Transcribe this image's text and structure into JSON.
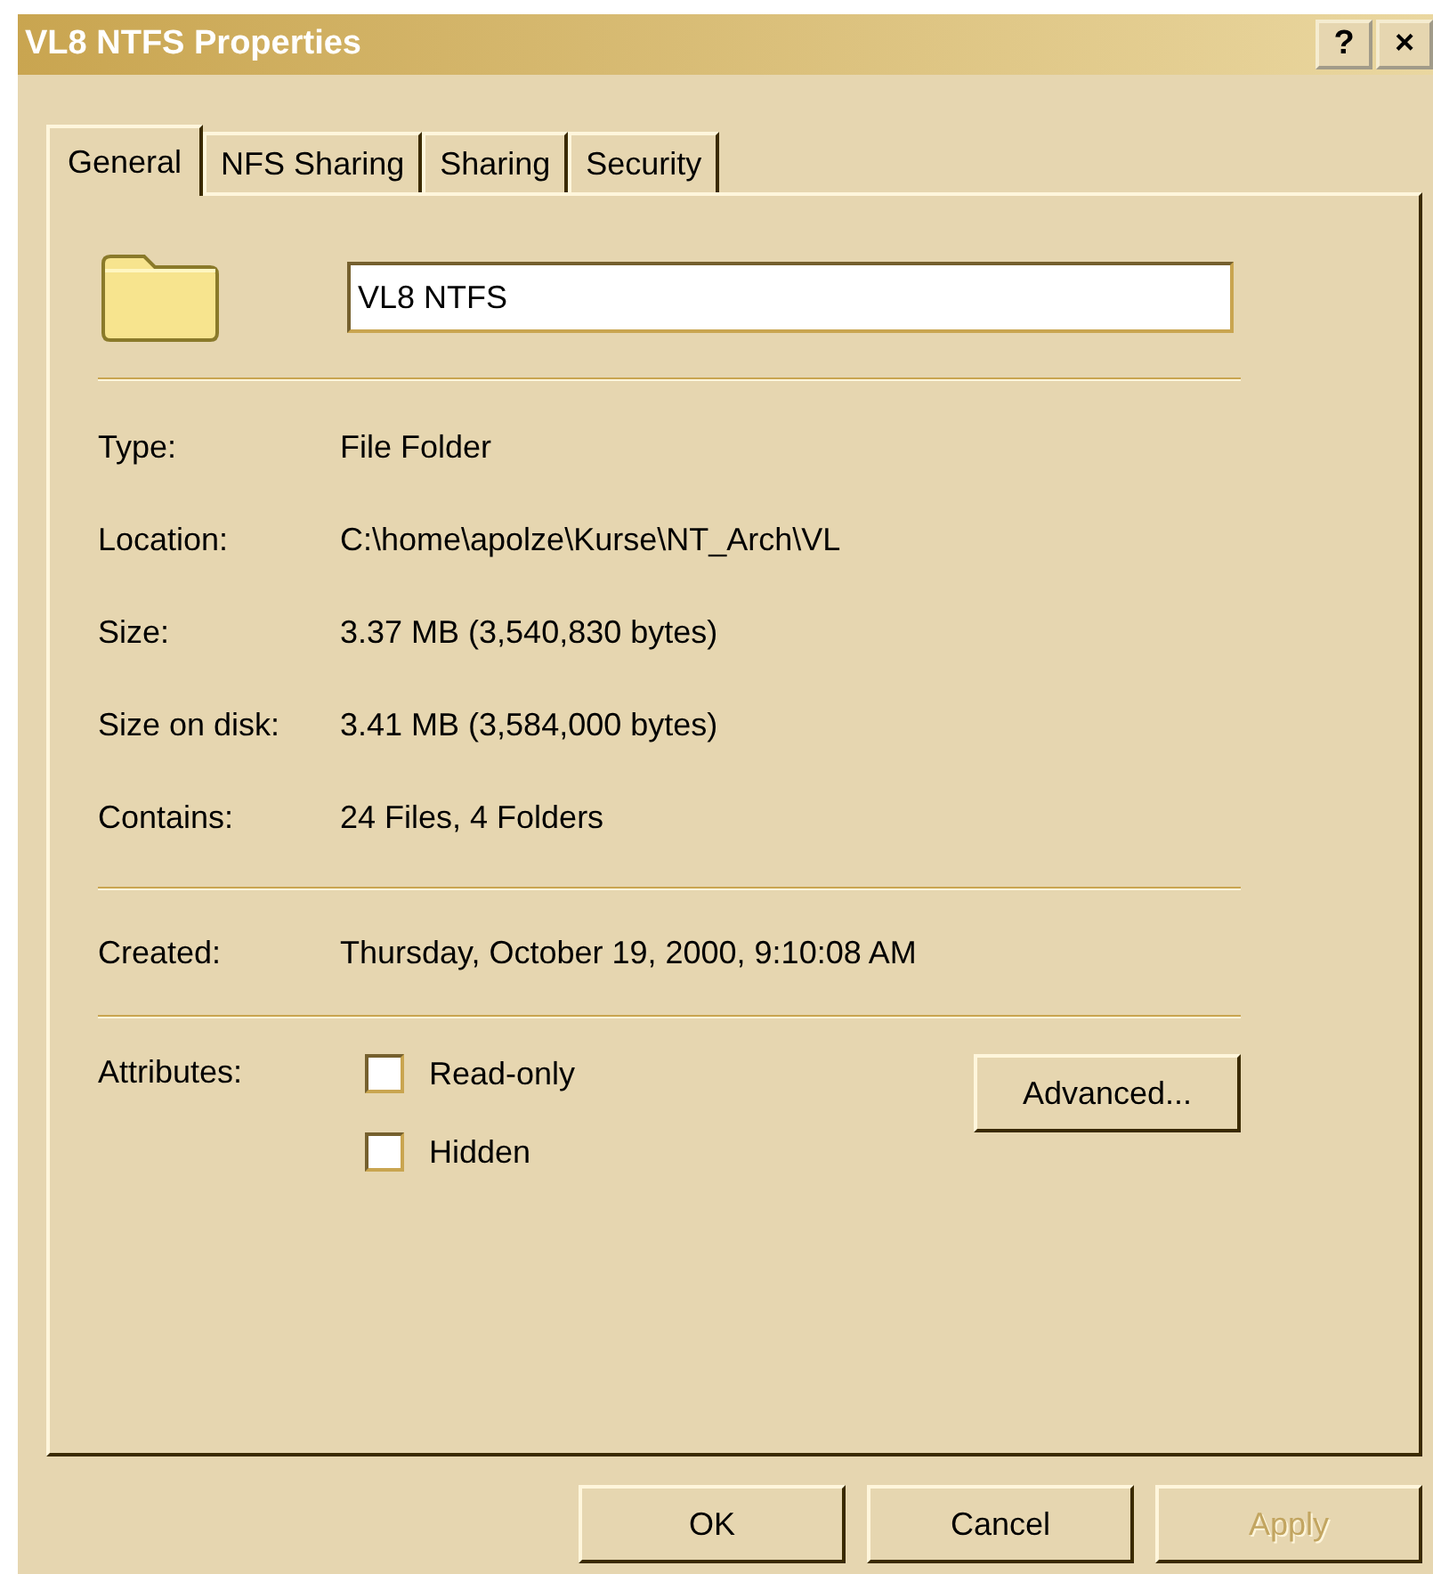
{
  "window": {
    "title": "VL8 NTFS Properties",
    "controls": [
      "?",
      "×"
    ]
  },
  "tabs": [
    {
      "label": "General",
      "selected": true
    },
    {
      "label": "NFS Sharing",
      "selected": false
    },
    {
      "label": "Sharing",
      "selected": false
    },
    {
      "label": "Security",
      "selected": false
    }
  ],
  "name_field": {
    "value": "VL8 NTFS"
  },
  "properties": [
    {
      "label": "Type:",
      "value": "File Folder"
    },
    {
      "label": "Location:",
      "value": "C:\\home\\apolze\\Kurse\\NT_Arch\\VL"
    },
    {
      "label": "Size:",
      "value": "3.37 MB (3,540,830 bytes)"
    },
    {
      "label": "Size on disk:",
      "value": "3.41 MB (3,584,000 bytes)"
    },
    {
      "label": "Contains:",
      "value": "24 Files, 4 Folders"
    }
  ],
  "created": {
    "label": "Created:",
    "value": "Thursday, October 19, 2000, 9:10:08 AM"
  },
  "attributes": {
    "label": "Attributes:",
    "checkboxes": [
      {
        "label": "Read-only",
        "checked": false
      },
      {
        "label": "Hidden",
        "checked": false
      }
    ],
    "advanced_button": "Advanced..."
  },
  "buttons": [
    {
      "label": "OK",
      "disabled": false
    },
    {
      "label": "Cancel",
      "disabled": false
    },
    {
      "label": "Apply",
      "disabled": true
    }
  ]
}
